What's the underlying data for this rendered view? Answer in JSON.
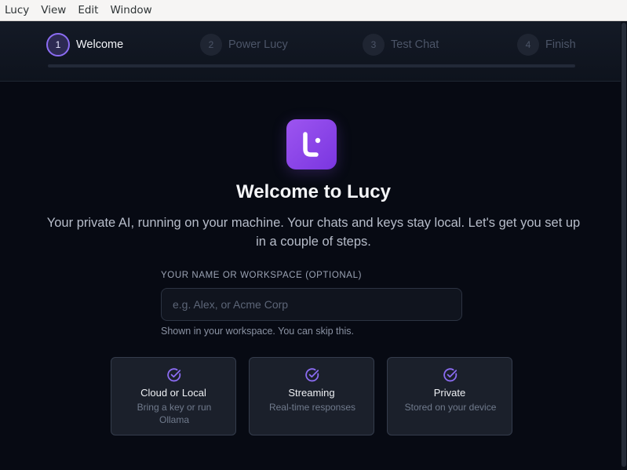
{
  "menubar": {
    "items": [
      "Lucy",
      "View",
      "Edit",
      "Window"
    ]
  },
  "stepper": {
    "steps": [
      {
        "number": "1",
        "label": "Welcome",
        "active": true
      },
      {
        "number": "2",
        "label": "Power Lucy",
        "active": false
      },
      {
        "number": "3",
        "label": "Test Chat",
        "active": false
      },
      {
        "number": "4",
        "label": "Finish",
        "active": false
      }
    ],
    "progress": 0
  },
  "welcome": {
    "title": "Welcome to Lucy",
    "subtitle": "Your private AI, running on your machine. Your chats and keys stay local. Let's get you set up in a couple of steps."
  },
  "name_field": {
    "label": "YOUR NAME OR WORKSPACE (OPTIONAL)",
    "placeholder": "e.g. Alex, or Acme Corp",
    "value": "",
    "hint": "Shown in your workspace. You can skip this."
  },
  "features": [
    {
      "icon": "check-circle-icon",
      "title": "Cloud or Local",
      "description": "Bring a key or run Ollama"
    },
    {
      "icon": "check-circle-icon",
      "title": "Streaming",
      "description": "Real-time responses"
    },
    {
      "icon": "check-circle-icon",
      "title": "Private",
      "description": "Stored on your device"
    }
  ],
  "colors": {
    "accent": "#8b6cf2",
    "logo_gradient_start": "#9d55f0",
    "logo_gradient_end": "#7a36e0",
    "background": "#070a13",
    "card_background": "#1b202b"
  }
}
